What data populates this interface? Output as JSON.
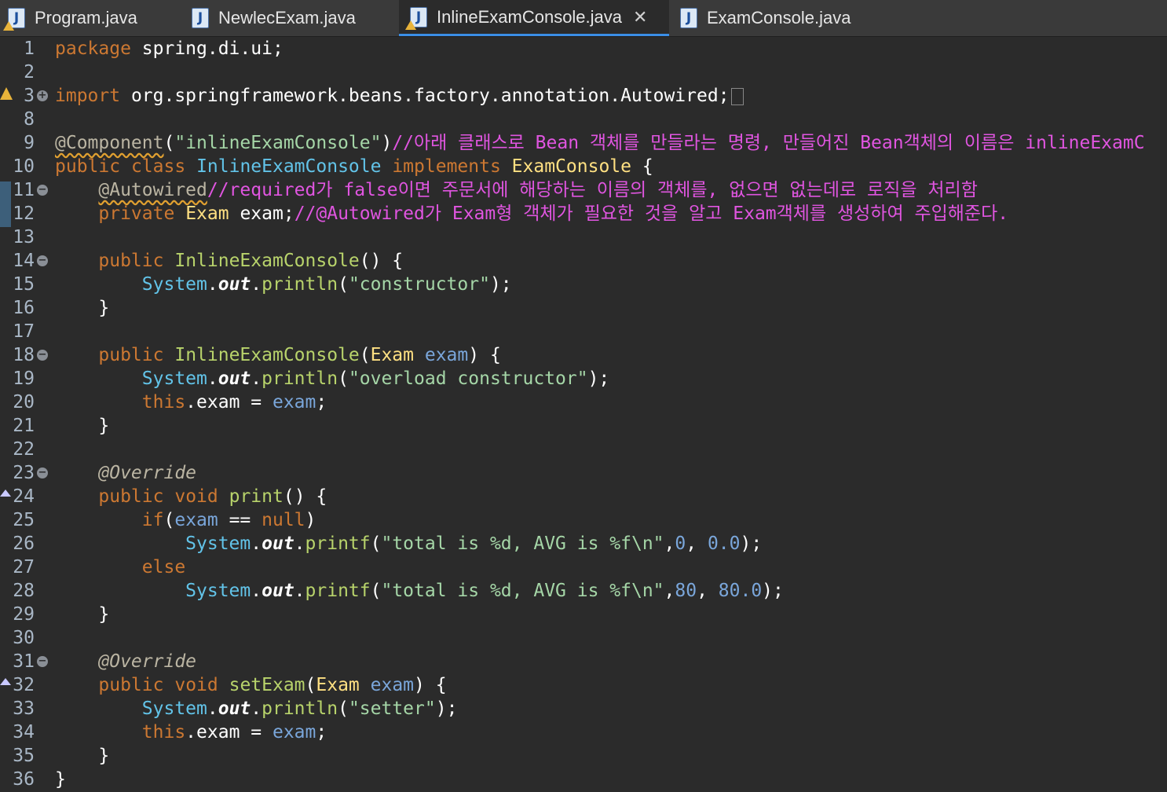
{
  "tabs": [
    {
      "label": "Program.java",
      "icon": "java-file-warning-icon"
    },
    {
      "label": "NewlecExam.java",
      "icon": "java-file-icon"
    },
    {
      "label": "InlineExamConsole.java",
      "icon": "java-file-warning-icon",
      "active": true,
      "close": "✕"
    },
    {
      "label": "ExamConsole.java",
      "icon": "java-file-icon"
    }
  ],
  "lines": [
    {
      "n": "1"
    },
    {
      "n": "2"
    },
    {
      "n": "3"
    },
    {
      "n": "8"
    },
    {
      "n": "9"
    },
    {
      "n": "10"
    },
    {
      "n": "11"
    },
    {
      "n": "12"
    },
    {
      "n": "13"
    },
    {
      "n": "14"
    },
    {
      "n": "15"
    },
    {
      "n": "16"
    },
    {
      "n": "17"
    },
    {
      "n": "18"
    },
    {
      "n": "19"
    },
    {
      "n": "20"
    },
    {
      "n": "21"
    },
    {
      "n": "22"
    },
    {
      "n": "23"
    },
    {
      "n": "24"
    },
    {
      "n": "25"
    },
    {
      "n": "26"
    },
    {
      "n": "27"
    },
    {
      "n": "28"
    },
    {
      "n": "29"
    },
    {
      "n": "30"
    },
    {
      "n": "31"
    },
    {
      "n": "32"
    },
    {
      "n": "33"
    },
    {
      "n": "34"
    },
    {
      "n": "35"
    },
    {
      "n": "36"
    }
  ],
  "code": {
    "l1": {
      "kw": "package",
      "rest": " spring.di.ui;"
    },
    "l3": {
      "kw": "import",
      "rest": " org.springframework.beans.factory.annotation.Autowired;"
    },
    "l9": {
      "ann": "@Component",
      "p1": "(",
      "str": "\"inlineExamConsole\"",
      "p2": ")",
      "cmt": "//아래 클래스로 Bean 객체를 만들라는 명령, 만들어진 Bean객체의 이름은 inlineExamC"
    },
    "l10": {
      "kw1": "public",
      "kw2": "class",
      "cls": "InlineExamConsole",
      "kw3": "implements",
      "iface": "ExamConsole",
      "brace": " {"
    },
    "l11": {
      "ann": "@Autowired",
      "cmt": "//required가 false이면 주문서에 해당하는 이름의 객체를, 없으면 없는데로 로직을 처리함"
    },
    "l12": {
      "kw": "private",
      "type": "Exam",
      "var": "exam;",
      "cmt": "//@Autowired가 Exam형 객체가 필요한 것을 알고 Exam객체를 생성하여 주입해준다."
    },
    "l14": {
      "kw": "public",
      "name": "InlineExamConsole",
      "rest": "() {"
    },
    "l15": {
      "sys": "System",
      "dot1": ".",
      "field": "out",
      "dot2": ".",
      "meth": "println",
      "p1": "(",
      "str": "\"constructor\"",
      "p2": ");"
    },
    "l16": {
      "text": "}"
    },
    "l18": {
      "kw": "public",
      "name": "InlineExamConsole",
      "p1": "(",
      "type": "Exam",
      "param": "exam",
      "p2": ") {"
    },
    "l19": {
      "sys": "System",
      "dot1": ".",
      "field": "out",
      "dot2": ".",
      "meth": "println",
      "p1": "(",
      "str": "\"overload constructor\"",
      "p2": ");"
    },
    "l20": {
      "kw": "this",
      "dot": ".",
      "field": "exam",
      "eq": " = ",
      "param": "exam",
      "semi": ";"
    },
    "l21": {
      "text": "}"
    },
    "l23": {
      "ann": "@Override"
    },
    "l24": {
      "kw1": "public",
      "kw2": "void",
      "meth": "print",
      "rest": "() {"
    },
    "l25": {
      "kw": "if",
      "p1": "(",
      "var": "exam",
      "op": " == ",
      "nul": "null",
      "p2": ")"
    },
    "l26": {
      "sys": "System",
      "dot1": ".",
      "field": "out",
      "dot2": ".",
      "meth": "printf",
      "p1": "(",
      "str": "\"total is %d, AVG is %f\\n\"",
      "c1": ",",
      "n1": "0",
      "c2": ", ",
      "n2": "0.0",
      "p2": ");"
    },
    "l27": {
      "kw": "else"
    },
    "l28": {
      "sys": "System",
      "dot1": ".",
      "field": "out",
      "dot2": ".",
      "meth": "printf",
      "p1": "(",
      "str": "\"total is %d, AVG is %f\\n\"",
      "c1": ",",
      "n1": "80",
      "c2": ", ",
      "n2": "80.0",
      "p2": ");"
    },
    "l29": {
      "text": "}"
    },
    "l31": {
      "ann": "@Override"
    },
    "l32": {
      "kw1": "public",
      "kw2": "void",
      "meth": "setExam",
      "p1": "(",
      "type": "Exam",
      "param": "exam",
      "p2": ") {"
    },
    "l33": {
      "sys": "System",
      "dot1": ".",
      "field": "out",
      "dot2": ".",
      "meth": "println",
      "p1": "(",
      "str": "\"setter\"",
      "p2": ");"
    },
    "l34": {
      "kw": "this",
      "dot": ".",
      "field": "exam",
      "eq": " = ",
      "param": "exam",
      "semi": ";"
    },
    "l35": {
      "text": "}"
    },
    "l36": {
      "text": "}"
    }
  },
  "colors": {
    "background": "#2b2b2b",
    "keyword": "#cc7832",
    "comment": "#e055e0",
    "string": "#a5d6a7",
    "active_tab_underline": "#3a8ee6"
  }
}
